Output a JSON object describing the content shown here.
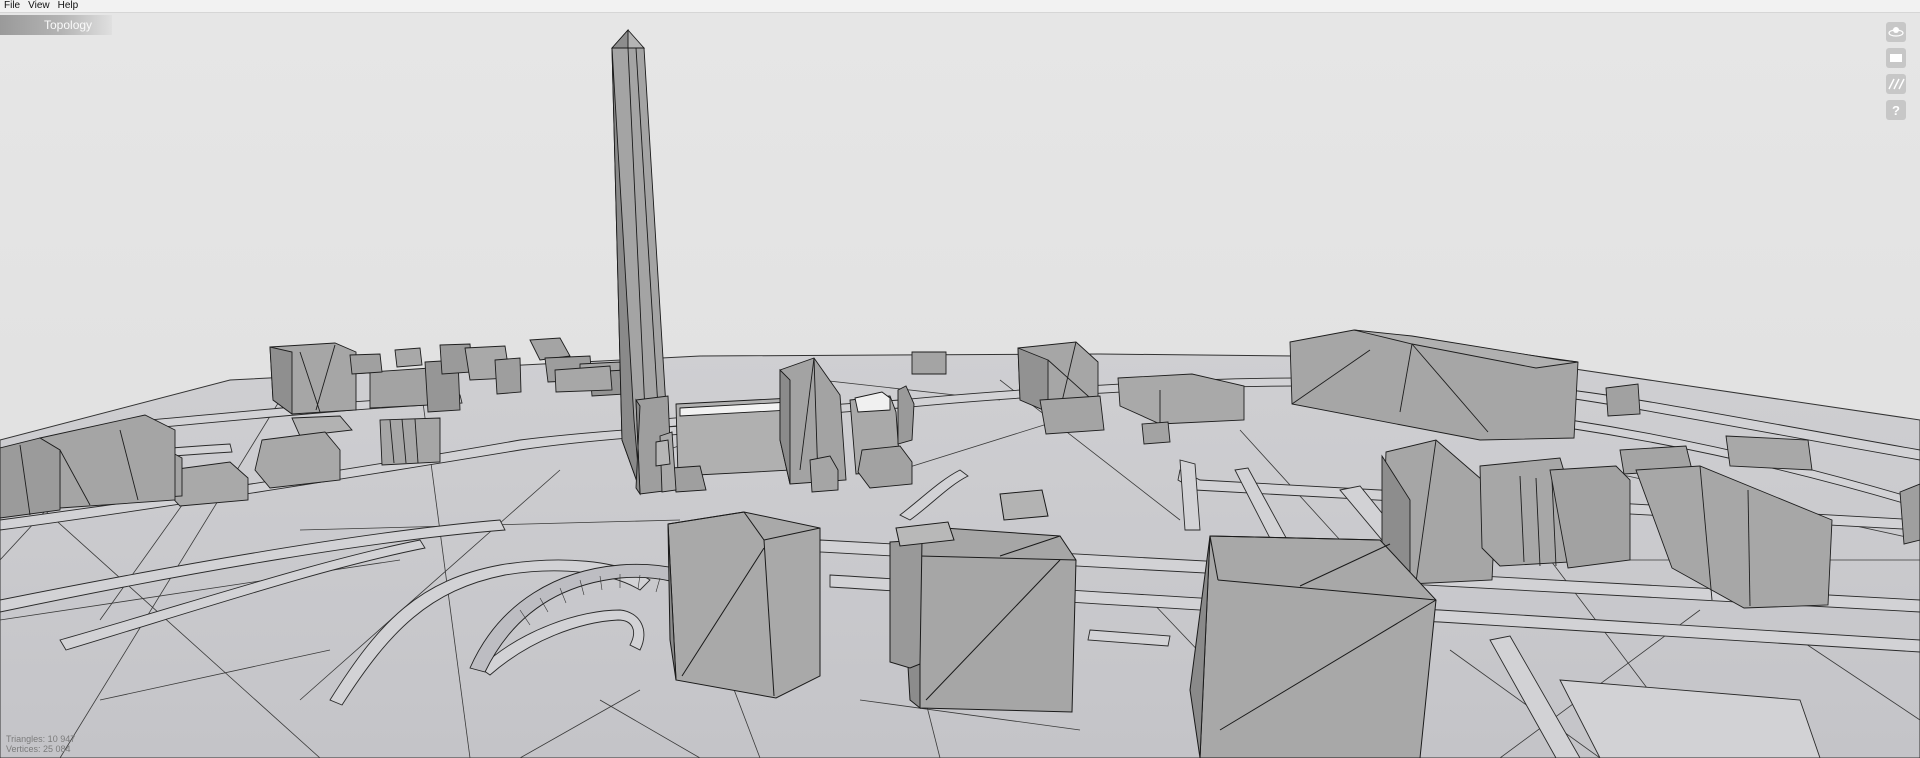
{
  "menu": {
    "file": "File",
    "view": "View",
    "help": "Help"
  },
  "panel": {
    "tab_label": "Topology"
  },
  "toolbar": {
    "buttons": [
      {
        "icon": "orbit-icon"
      },
      {
        "icon": "view-mode-icon"
      },
      {
        "icon": "texture-icon"
      },
      {
        "icon": "help-icon"
      }
    ]
  },
  "stats": {
    "triangles_label": "Triangles: 10 947",
    "vertices_label": "Vertices: 25 084"
  },
  "colors": {
    "background": "#e4e4e4",
    "ground": "#c9c9c9",
    "building_light": "#a9a9a9",
    "building_dark": "#8a8a8a",
    "edges": "#222222"
  }
}
